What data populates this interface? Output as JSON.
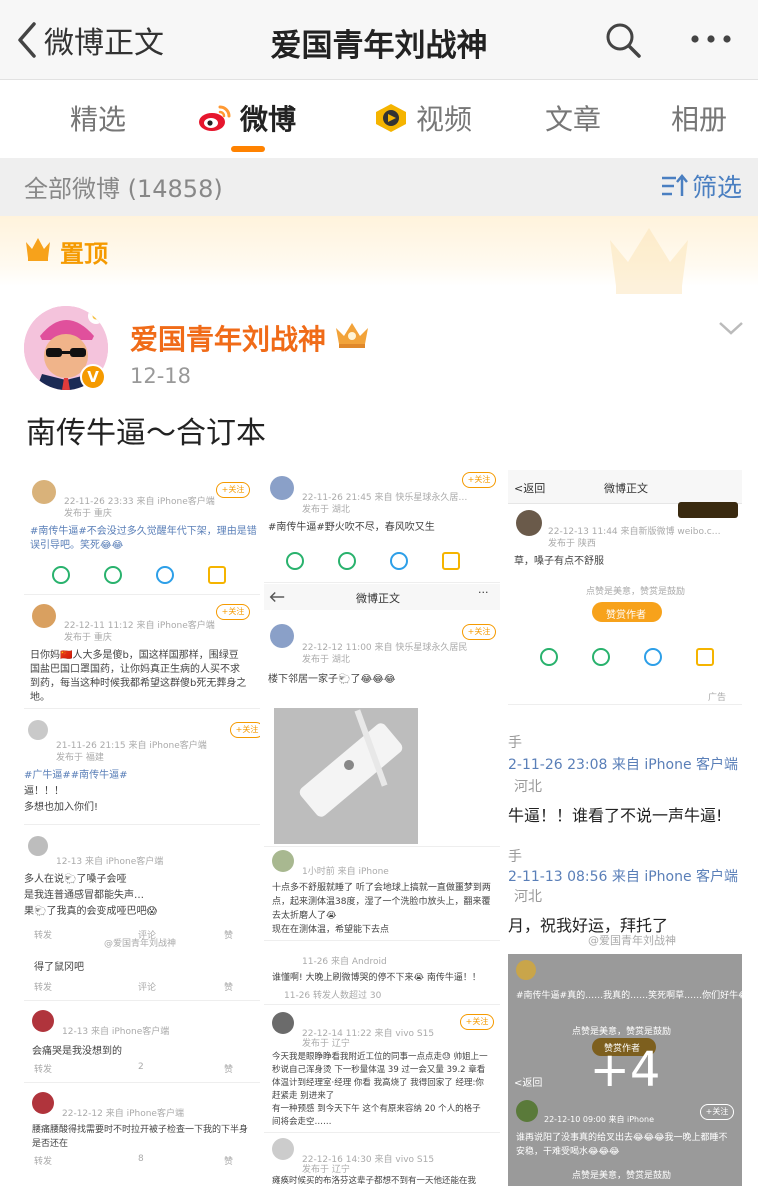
{
  "nav": {
    "back_label": "微博正文",
    "title": "爱国青年刘战神"
  },
  "tabs": [
    {
      "label": "精选"
    },
    {
      "label": "微博"
    },
    {
      "label": "视频"
    },
    {
      "label": "文章"
    },
    {
      "label": "相册"
    }
  ],
  "filter": {
    "count_label": "全部微博 (14858)",
    "filter_label": "筛选"
  },
  "pinned": {
    "label": "置顶"
  },
  "post": {
    "username": "爱国青年刘战神",
    "date": "12-18",
    "text": "南传牛逼～合订本",
    "more_images": "+4"
  },
  "shot_a": {
    "p1_time": "22-11-26 23:33 来自 iPhone客户端",
    "p1_loc": "发布于 重庆",
    "p1_text1": "#南传牛逼#不会没过多久觉醒年代下架，理由是错",
    "p1_text2": "误引导吧。笑死😂😂",
    "follow": "+关注",
    "p2_time": "22-12-11 11:12 来自 iPhone客户端",
    "p2_loc": "发布于 重庆",
    "p2_text1": "日你妈🇨🇳人大多是傻b，国这样国那样，围绿豆",
    "p2_text2": "国盐巴国口罩国药，让你妈真正生病的人买不求",
    "p2_text3": "到药，每当这种时候我都希望这群傻b死无葬身之",
    "p2_text4": "地。",
    "p3_time": "21-11-26 21:15 来自 iPhone客户端",
    "p3_loc": "发布于 福建",
    "p3_text1": "#广牛逼##南传牛逼#",
    "p3_text2": "逼！！！",
    "p3_text3": "多想也加入你们!",
    "p4_time": "12-13 来自 iPhone客户端",
    "p4_text1": "多人在说🐑了嗓子会哑",
    "p4_text2": "是我连普通感冒都能失声…",
    "p4_text3": "果🐑了我真的会变成哑巴吧😱",
    "actions_forward": "转发",
    "actions_comment": "评论",
    "actions_like": "赞",
    "p5_text": "得了鼠冈吧",
    "p6_time": "12-13 来自 iPhone客户端",
    "p6_text": "会痛哭是我没想到的",
    "count_2": "2",
    "p7_time": "22-12-12 来自 iPhone客户端",
    "p7_text1": "腰痛腰酸得找需要时不时拉开被子检查一下我的下半身",
    "p7_text2": "是否还在",
    "count_8": "8",
    "watermark": "@爱国青年刘战神"
  },
  "shot_b": {
    "p1_time": "22-11-26 21:45 来自 快乐星球永久居…",
    "p1_loc": "发布于 湖北",
    "p1_text": "#南传牛逼#野火吹不尽，春风吹又生",
    "nav_title": "微博正文",
    "p2_time": "22-12-12 11:00 来自 快乐星球永久居民",
    "p2_loc": "发布于 湖北",
    "p2_text": "楼下邻居一家子🐑了😂😂😂",
    "c1_source": "1小时前 来自 iPhone",
    "c1_text1": "十点多不舒服就睡了 听了会地球上搞就一直做噩梦到两",
    "c1_text2": "点，起来测体温38度，湿了一个洗脸巾放头上，翻来覆",
    "c1_text3": "去太折磨人了😭",
    "c1_text4": "现在在测体温，希望能下去点",
    "c2_source": "11-26 来自 Android",
    "c2_text": "谁懂啊! 大晚上刷微博哭的停不下来😭 南传牛逼！！",
    "c2_meta": "11-26 转发人数超过 30",
    "c3_time": "22-12-14 11:22 来自 vivo S15",
    "c3_loc": "发布于 辽宁",
    "c3_text1": "今天我是眼睁睁看我附近工位的同事一点点走😓 帅姐上一",
    "c3_text2": "秒说自己浑身烫 下一秒量体温 39 过一会又量 39.2 章看",
    "c3_text3": "体温计到经理室·经理 你看 我高烧了 我得回家了 经理:你",
    "c3_text4": "赶紧走 别进来了",
    "c3_text5": "有一种预感 到今天下午 这个有原来容纳 20 个人的格子",
    "c3_text6": "间将会走空……",
    "c4_time": "22-12-16 14:30 来自 vivo S15",
    "c4_loc": "发布于 辽宁",
    "c4_text": "瘫痪时候买的布洛芬这辈子都想不到有一天他还能在我"
  },
  "shot_c": {
    "nav_back": "返回",
    "nav_title": "微博正文",
    "p1_time": "22-12-13 11:44 来自新版微博 weibo.c…",
    "p1_loc": "发布于 陕西",
    "p1_text": "草，嗓子有点不舒服",
    "reward_hint": "点赞是美意，赞赏是鼓励",
    "reward_btn": "赞赏作者",
    "ad": "广告",
    "p2_time": "2-11-26 23:08 来自 iPhone 客户端",
    "p2_loc": "河北",
    "p2_text": "牛逼！！谁看了不说一声牛逼!",
    "p3_time": "2-11-13 08:56 来自 iPhone 客户端",
    "p3_loc": "河北",
    "p3_text": "月，祝我好运，拜托了",
    "watermark": "@爱国青年刘战神"
  },
  "shot_d": {
    "p1_text": "#南传牛逼#真的……我真的……笑死啊草……你们好牛😂",
    "reward_hint": "点赞是美意，赞赏是鼓励",
    "reward_btn": "赞赏作者",
    "nav_back": "返回",
    "p2_time": "22-12-10 09:00 来自 iPhone",
    "p2_text1": "谁再说阳了没事真的给叉出去😂😂😂我一晚上都睡不",
    "p2_text2": "安稳，干难受喝水😂😂😂",
    "follow": "+关注"
  }
}
